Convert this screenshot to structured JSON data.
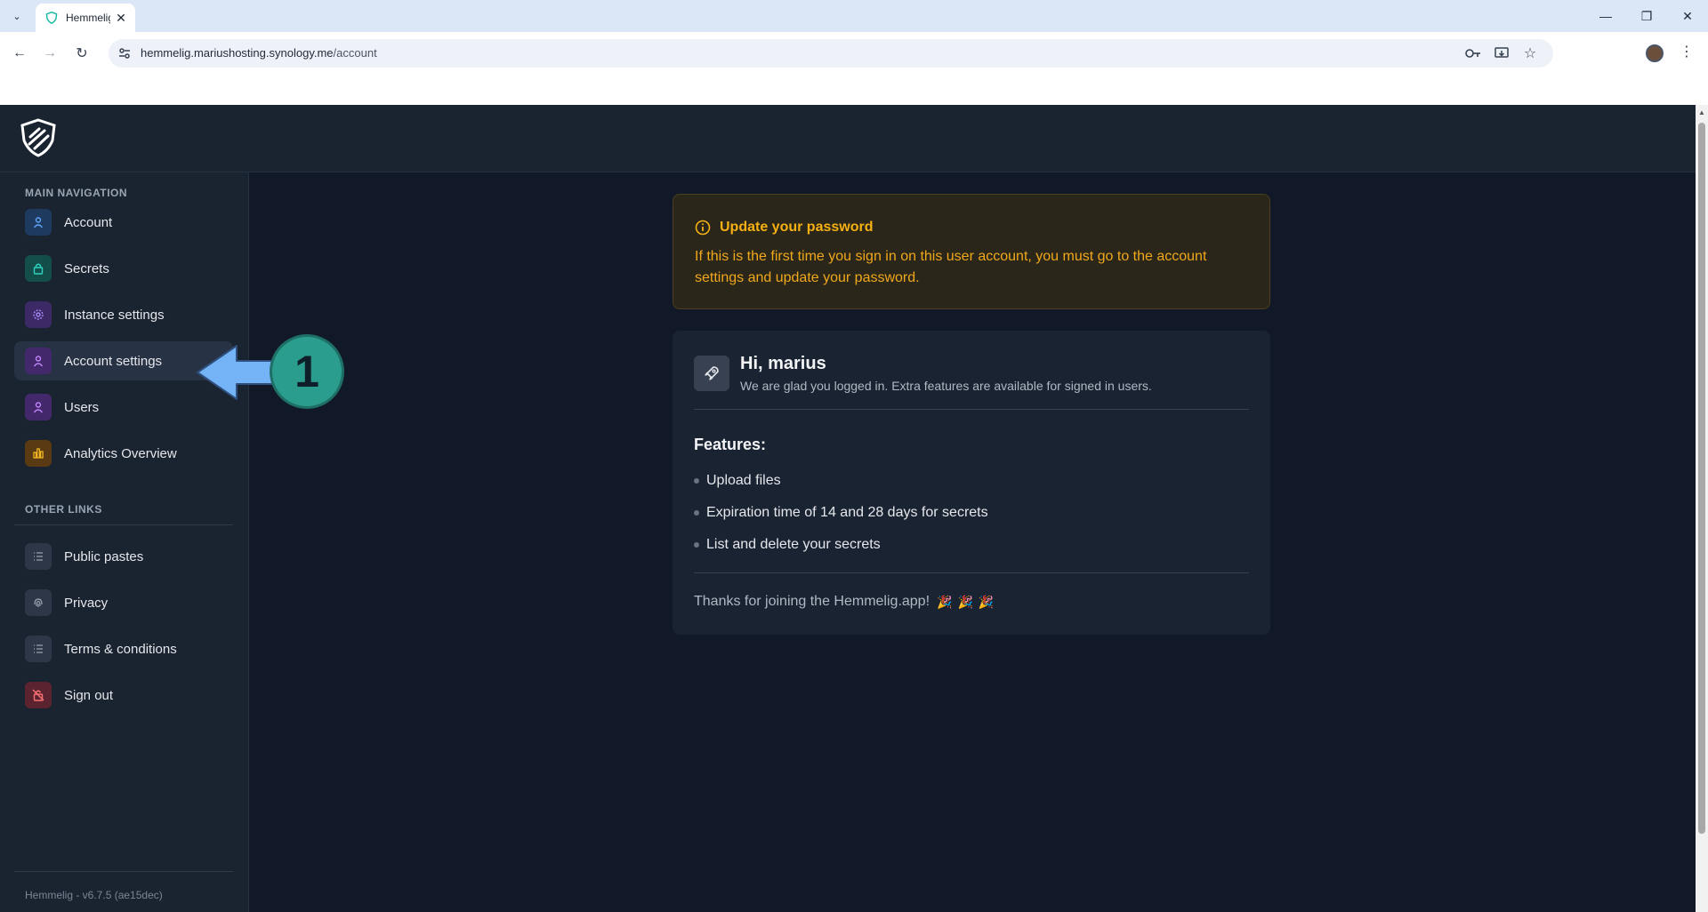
{
  "browser": {
    "tab_title": "Hemmelig",
    "url_host": "hemmelig.mariushosting.synology.me",
    "url_path": "/account"
  },
  "sidebar": {
    "main_nav_label": "MAIN NAVIGATION",
    "main_items": [
      {
        "label": "Account",
        "icon": "user-icon",
        "color": "#3b82f6"
      },
      {
        "label": "Secrets",
        "icon": "lock-icon",
        "color": "#14b8a6"
      },
      {
        "label": "Instance settings",
        "icon": "gear-icon",
        "color": "#8b5cf6"
      },
      {
        "label": "Account settings",
        "icon": "user-icon",
        "color": "#a855f7"
      },
      {
        "label": "Users",
        "icon": "user-icon",
        "color": "#a855f7"
      },
      {
        "label": "Analytics Overview",
        "icon": "bar-chart-icon",
        "color": "#f59e0b"
      }
    ],
    "other_links_label": "OTHER LINKS",
    "other_items": [
      {
        "label": "Public pastes",
        "icon": "list-icon"
      },
      {
        "label": "Privacy",
        "icon": "fingerprint-icon"
      },
      {
        "label": "Terms & conditions",
        "icon": "list-icon"
      },
      {
        "label": "Sign out",
        "icon": "lock-off-icon",
        "color": "#ef4444"
      }
    ],
    "version": "Hemmelig - v6.7.5 (ae15dec)"
  },
  "alert": {
    "title": "Update your password",
    "text": "If this is the first time you sign in on this user account, you must go to the account settings and update your password."
  },
  "welcome": {
    "greeting": "Hi, marius",
    "subtitle": "We are glad you logged in. Extra features are available for signed in users.",
    "features_title": "Features:",
    "features": [
      "Upload files",
      "Expiration time of 14 and 28 days for secrets",
      "List and delete your secrets"
    ],
    "thanks": "Thanks for joining the Hemmelig.app!",
    "party": "🎉🎉🎉"
  },
  "annotation": {
    "step": "1"
  }
}
